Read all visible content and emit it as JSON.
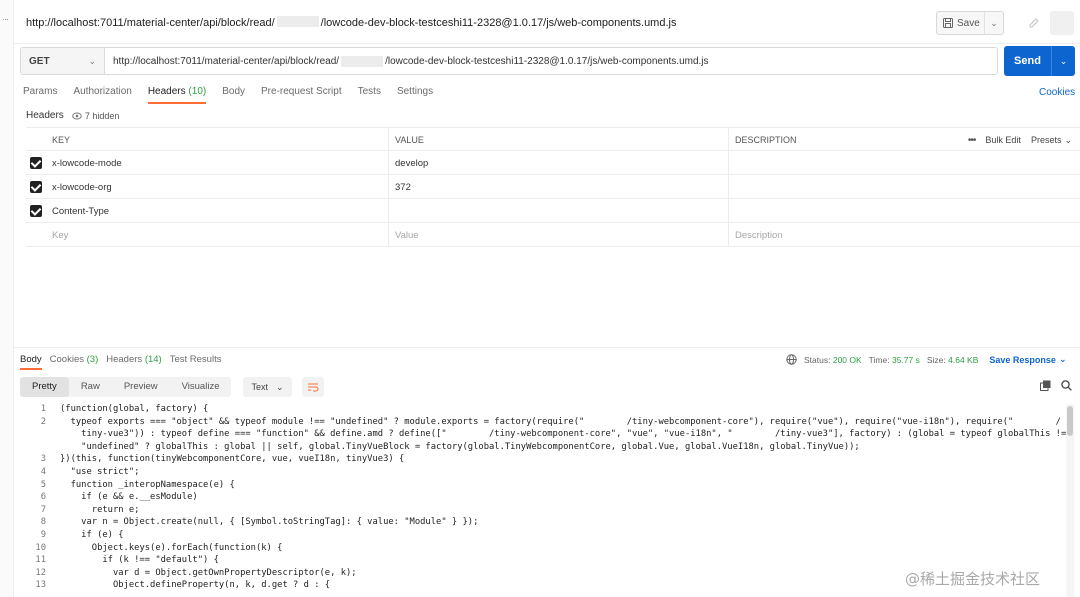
{
  "request": {
    "title_prefix": "http://localhost:7011/material-center/api/block/read/",
    "title_suffix": "/lowcode-dev-block-testceshi11-2328@1.0.17/js/web-components.umd.js",
    "save_label": "Save",
    "method": "GET",
    "url_prefix": "http://localhost:7011/material-center/api/block/read/",
    "url_suffix": "/lowcode-dev-block-testceshi11-2328@1.0.17/js/web-components.umd.js",
    "send_label": "Send",
    "tabs": [
      {
        "label": "Params",
        "count": ""
      },
      {
        "label": "Authorization",
        "count": ""
      },
      {
        "label": "Headers",
        "count": "(10)"
      },
      {
        "label": "Body",
        "count": ""
      },
      {
        "label": "Pre-request Script",
        "count": ""
      },
      {
        "label": "Tests",
        "count": ""
      },
      {
        "label": "Settings",
        "count": ""
      }
    ],
    "cookies_label": "Cookies"
  },
  "headers": {
    "sub_label": "Headers",
    "hidden_label": "7 hidden",
    "columns": {
      "key": "KEY",
      "value": "VALUE",
      "description": "DESCRIPTION"
    },
    "bulk_edit_label": "Bulk Edit",
    "presets_label": "Presets",
    "rows": [
      {
        "key": "x-lowcode-mode",
        "value": "develop",
        "description": ""
      },
      {
        "key": "x-lowcode-org",
        "value": "372",
        "description": ""
      },
      {
        "key": "Content-Type",
        "value": "",
        "description": ""
      }
    ],
    "placeholders": {
      "key": "Key",
      "value": "Value",
      "description": "Description"
    }
  },
  "response": {
    "tabs": [
      {
        "label": "Body",
        "count": ""
      },
      {
        "label": "Cookies",
        "count": "(3)"
      },
      {
        "label": "Headers",
        "count": "(14)"
      },
      {
        "label": "Test Results",
        "count": ""
      }
    ],
    "status_label": "Status:",
    "status_value": "200 OK",
    "time_label": "Time:",
    "time_value": "35.77 s",
    "size_label": "Size:",
    "size_value": "4.64 KB",
    "save_response_label": "Save Response",
    "views": [
      "Pretty",
      "Raw",
      "Preview",
      "Visualize"
    ],
    "format": "Text",
    "code_lines": [
      {
        "n": "1",
        "t": "(function(global, factory) {"
      },
      {
        "n": "2",
        "t": "  typeof exports === \"object\" && typeof module !== \"undefined\" ? module.exports = factory(require(\"        /tiny-webcomponent-core\"), require(\"vue\"), require(\"vue-i18n\"), require(\"        /"
      },
      {
        "n": "",
        "t": "    tiny-vue3\")) : typeof define === \"function\" && define.amd ? define([\"        /tiny-webcomponent-core\", \"vue\", \"vue-i18n\", \"        /tiny-vue3\"], factory) : (global = typeof globalThis !=="
      },
      {
        "n": "",
        "t": "    \"undefined\" ? globalThis : global || self, global.TinyVueBlock = factory(global.TinyWebcomponentCore, global.Vue, global.VueI18n, global.TinyVue));"
      },
      {
        "n": "3",
        "t": "})(this, function(tinyWebcomponentCore, vue, vueI18n, tinyVue3) {"
      },
      {
        "n": "4",
        "t": "  \"use strict\";"
      },
      {
        "n": "5",
        "t": "  function _interopNamespace(e) {"
      },
      {
        "n": "6",
        "t": "    if (e && e.__esModule)"
      },
      {
        "n": "7",
        "t": "      return e;"
      },
      {
        "n": "8",
        "t": "    var n = Object.create(null, { [Symbol.toStringTag]: { value: \"Module\" } });"
      },
      {
        "n": "9",
        "t": "    if (e) {"
      },
      {
        "n": "10",
        "t": "      Object.keys(e).forEach(function(k) {"
      },
      {
        "n": "11",
        "t": "        if (k !== \"default\") {"
      },
      {
        "n": "12",
        "t": "          var d = Object.getOwnPropertyDescriptor(e, k);"
      },
      {
        "n": "13",
        "t": "          Object.defineProperty(n, k, d.get ? d : {"
      }
    ]
  },
  "watermark": "@稀土掘金技术社区"
}
